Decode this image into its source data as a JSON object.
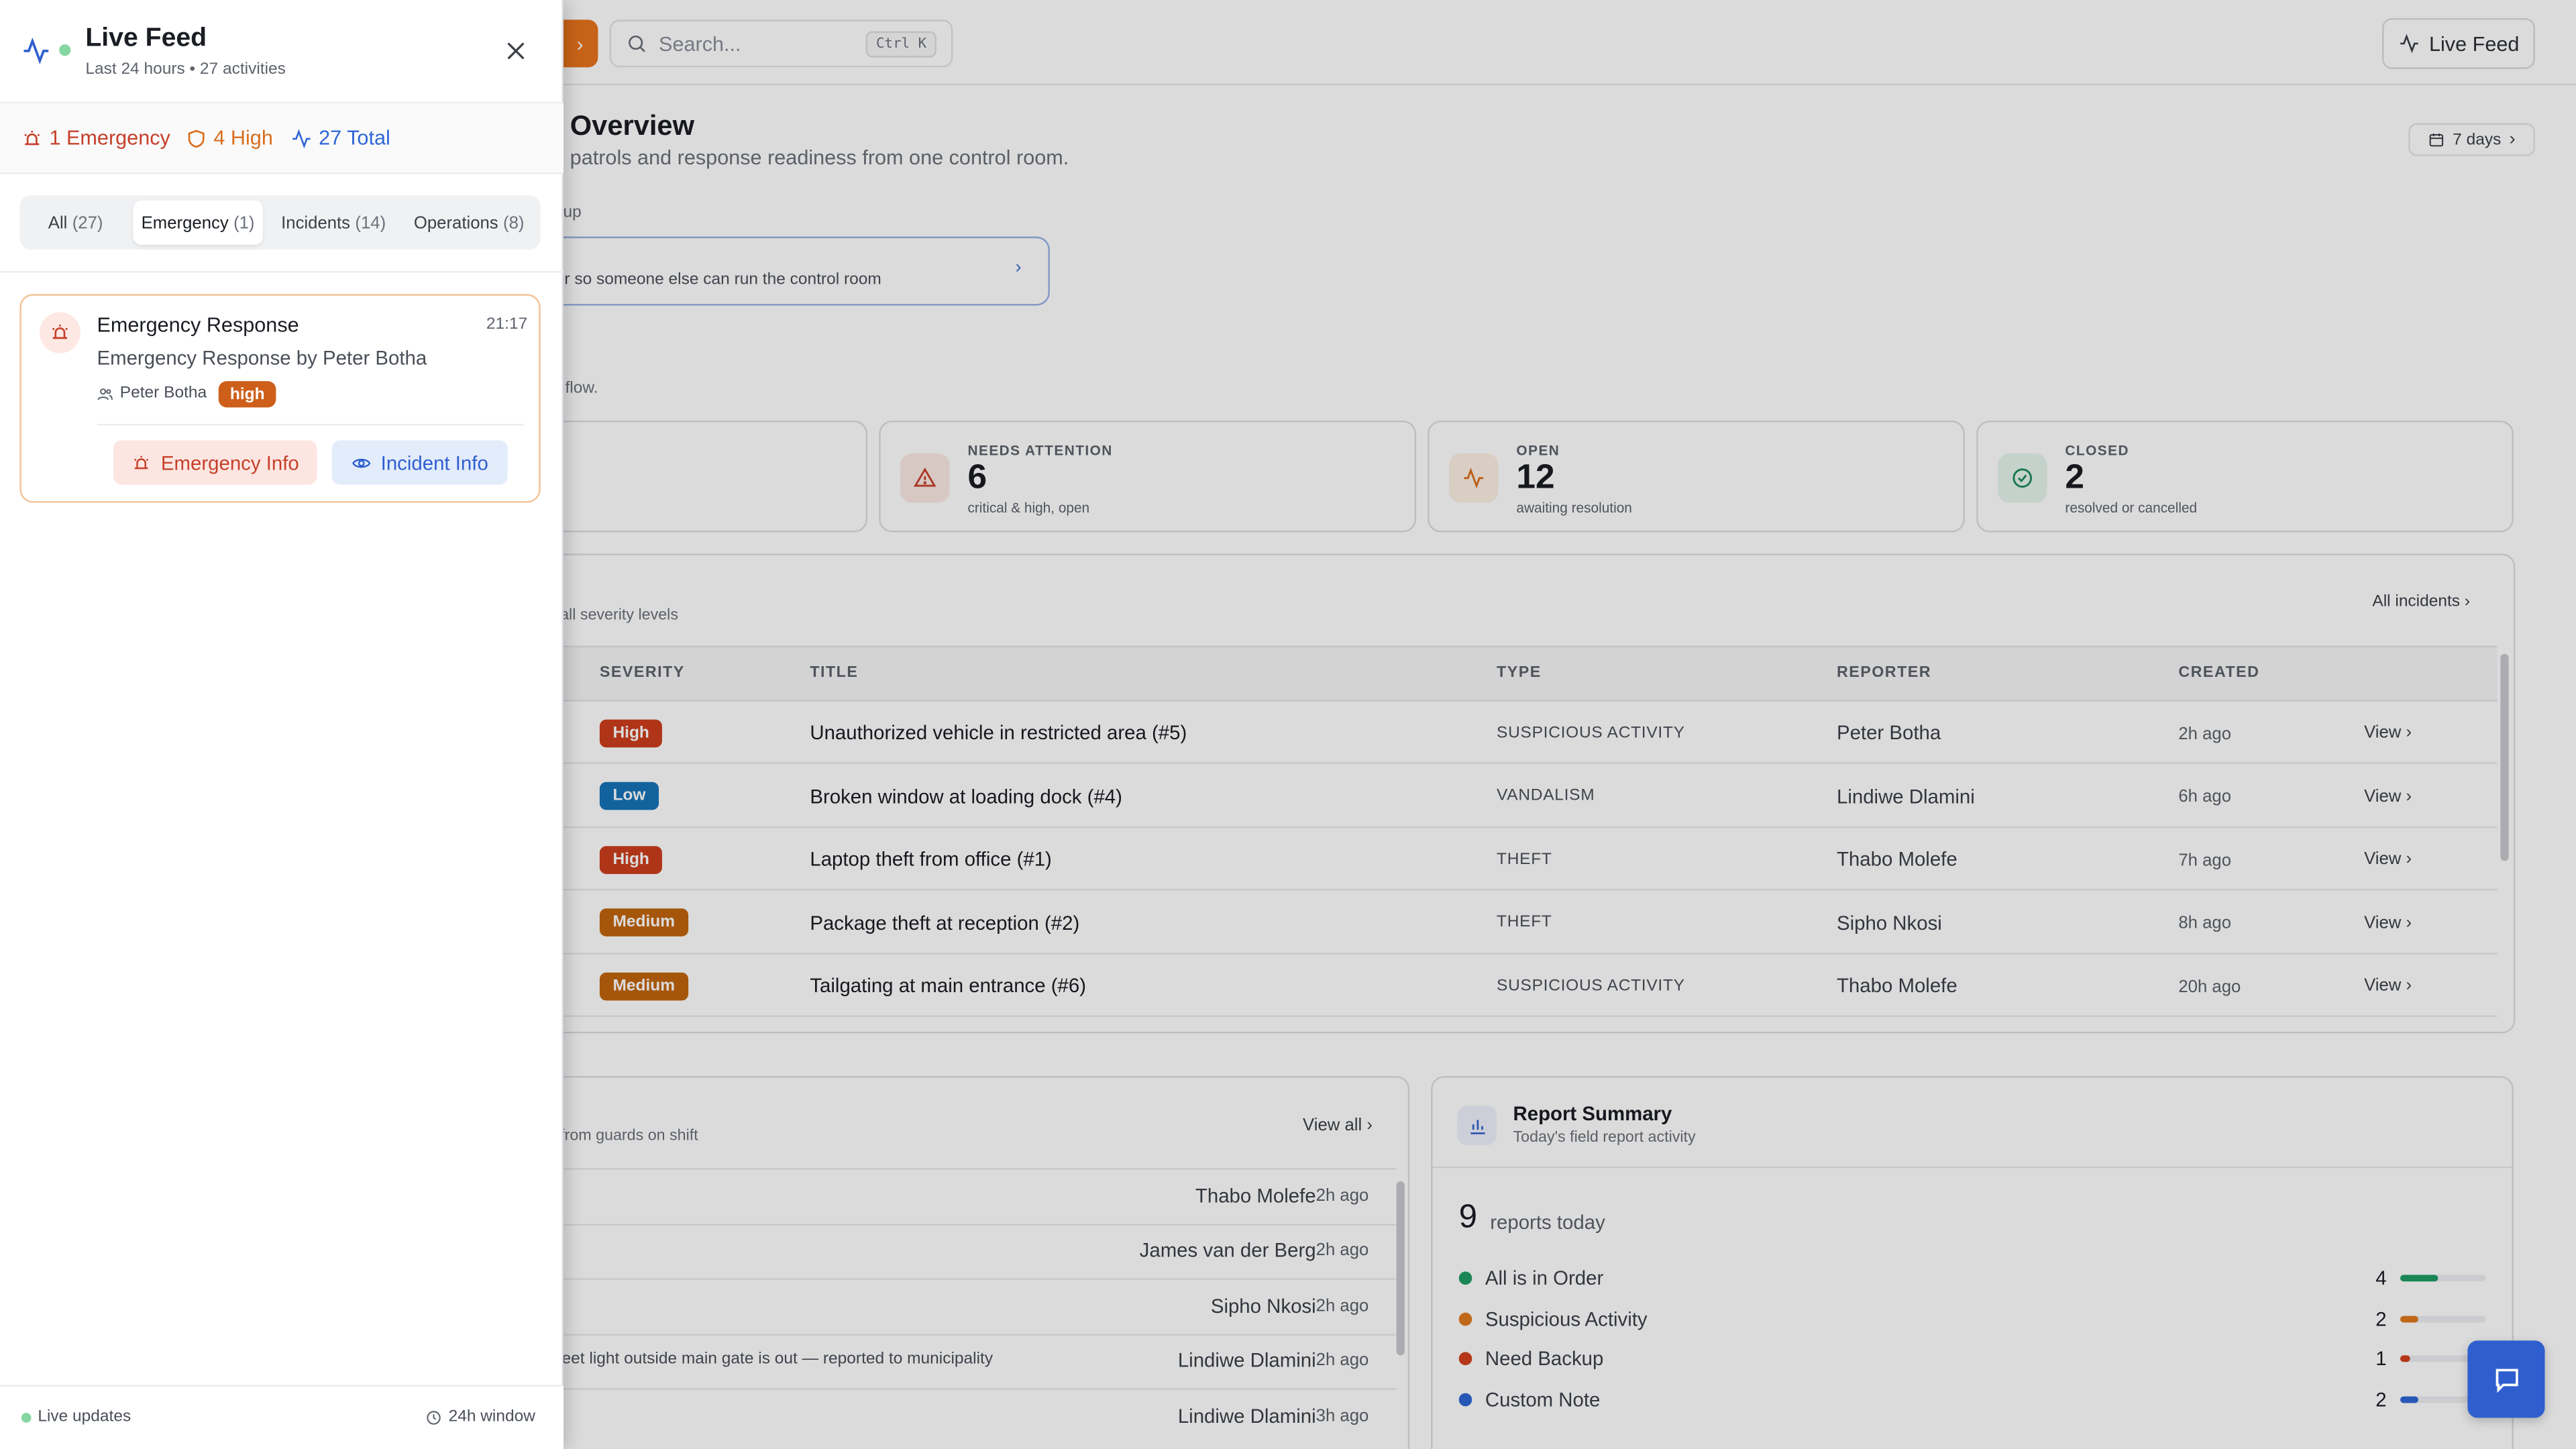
{
  "topbar": {
    "search_placeholder": "Search...",
    "search_shortcut": "Ctrl K",
    "live_feed_label": "Live Feed"
  },
  "overview": {
    "title": "Overview",
    "subtitle": ", patrols and response readiness from one control room.",
    "range_label": "7 days",
    "setup_label": "tup",
    "setup_text": "er so someone else can run the control room",
    "flow_text": " flow."
  },
  "stats": [
    {
      "label": "NEEDS ATTENTION",
      "value": "6",
      "desc": "critical & high, open",
      "icon": "alert-triangle-icon",
      "color": "#c6402a",
      "bg": "#fbe9e5"
    },
    {
      "label": "OPEN",
      "value": "12",
      "desc": "awaiting resolution",
      "icon": "activity-icon",
      "color": "#d96e1e",
      "bg": "#fdf0e4"
    },
    {
      "label": "CLOSED",
      "value": "2",
      "desc": "resolved or cancelled",
      "icon": "check-circle-icon",
      "color": "#1b8a5a",
      "bg": "#e5f5ed"
    }
  ],
  "incidents": {
    "subtitle": "all severity levels",
    "all_link": "All incidents",
    "headers": [
      "SEVERITY",
      "TITLE",
      "TYPE",
      "REPORTER",
      "CREATED"
    ],
    "rows": [
      {
        "severity": "High",
        "sev_color": "#cd3e1c",
        "title": "Unauthorized vehicle in restricted area (#5)",
        "type": "SUSPICIOUS ACTIVITY",
        "reporter": "Peter Botha",
        "created": "2h ago",
        "view": "View"
      },
      {
        "severity": "Low",
        "sev_color": "#1673b8",
        "title": "Broken window at loading dock (#4)",
        "type": "VANDALISM",
        "reporter": "Lindiwe Dlamini",
        "created": "6h ago",
        "view": "View"
      },
      {
        "severity": "High",
        "sev_color": "#cd3e1c",
        "title": "Laptop theft from office (#1)",
        "type": "THEFT",
        "reporter": "Thabo Molefe",
        "created": "7h ago",
        "view": "View"
      },
      {
        "severity": "Medium",
        "sev_color": "#c2650d",
        "title": "Package theft at reception (#2)",
        "type": "THEFT",
        "reporter": "Sipho Nkosi",
        "created": "8h ago",
        "view": "View"
      },
      {
        "severity": "Medium",
        "sev_color": "#c2650d",
        "title": "Tailgating at main entrance (#6)",
        "type": "SUSPICIOUS ACTIVITY",
        "reporter": "Thabo Molefe",
        "created": "20h ago",
        "view": "View"
      }
    ]
  },
  "reports": {
    "subtitle": "from guards on shift",
    "view_all": "View all",
    "rows": [
      {
        "note": "",
        "name": "Thabo Molefe",
        "time": "2h ago"
      },
      {
        "note": "",
        "name": "James van der Berg",
        "time": "2h ago"
      },
      {
        "note": "",
        "name": "Sipho Nkosi",
        "time": "2h ago"
      },
      {
        "note": "eet light outside main gate is out — reported to municipality",
        "name": "Lindiwe Dlamini",
        "time": "2h ago"
      },
      {
        "note": "",
        "name": "Lindiwe Dlamini",
        "time": "3h ago"
      }
    ]
  },
  "summary": {
    "title": "Report Summary",
    "subtitle": "Today's field report activity",
    "total": "9",
    "total_label": "reports today",
    "categories": [
      {
        "label": "All is in Order",
        "count": "4",
        "fraction": 0.44,
        "color": "#1f9d63"
      },
      {
        "label": "Suspicious Activity",
        "count": "2",
        "fraction": 0.22,
        "color": "#e07a1f"
      },
      {
        "label": "Need Backup",
        "count": "1",
        "fraction": 0.11,
        "color": "#d2401f"
      },
      {
        "label": "Custom Note",
        "count": "2",
        "fraction": 0.22,
        "color": "#2f67d6"
      }
    ]
  },
  "panel": {
    "title": "Live Feed",
    "subtitle": "Last 24 hours • 27 activities",
    "counts": {
      "emergency": "1 Emergency",
      "high": "4 High",
      "total": "27 Total"
    },
    "tabs": [
      {
        "label": "All",
        "count": "(27)"
      },
      {
        "label": "Emergency",
        "count": "(1)"
      },
      {
        "label": "Incidents",
        "count": "(14)"
      },
      {
        "label": "Operations",
        "count": "(8)"
      }
    ],
    "card": {
      "title": "Emergency Response",
      "time": "21:17",
      "desc": "Emergency Response by Peter Botha",
      "user": "Peter Botha",
      "severity": "high",
      "btn_emergency": "Emergency Info",
      "btn_incident": "Incident Info"
    },
    "footer": {
      "live": "Live updates",
      "window": "24h window"
    }
  },
  "colors": {
    "accent": "#e8741d",
    "brand_blue": "#2f5fcf"
  }
}
